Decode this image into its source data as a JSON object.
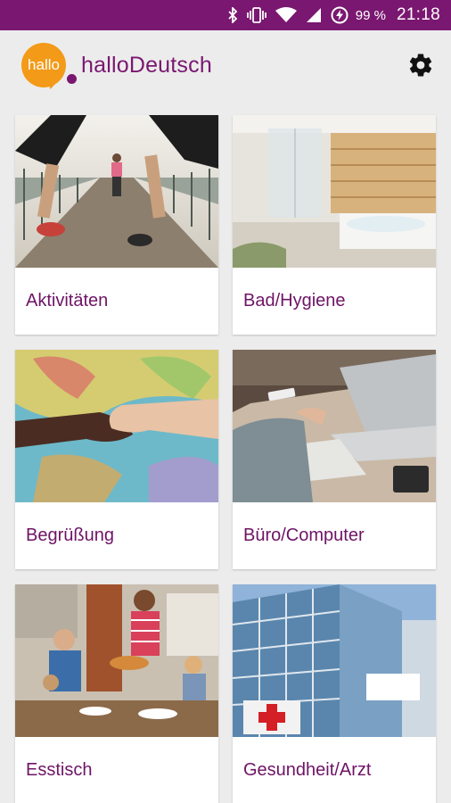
{
  "status_bar": {
    "battery_percent": "99 %",
    "time": "21:18",
    "icons": [
      "bluetooth-icon",
      "vibrate-icon",
      "wifi-icon",
      "signal-icon",
      "battery-charging-icon"
    ]
  },
  "app": {
    "logo_text": "hallo",
    "title": "halloDeutsch",
    "settings_icon": "gear-icon"
  },
  "colors": {
    "primary": "#7a1770",
    "accent": "#f39a18",
    "background": "#ececec"
  },
  "categories": [
    {
      "label": "Aktivitäten"
    },
    {
      "label": "Bad/Hygiene"
    },
    {
      "label": "Begrüßung"
    },
    {
      "label": "Büro/Computer"
    },
    {
      "label": "Esstisch"
    },
    {
      "label": "Gesundheit/Arzt"
    }
  ]
}
